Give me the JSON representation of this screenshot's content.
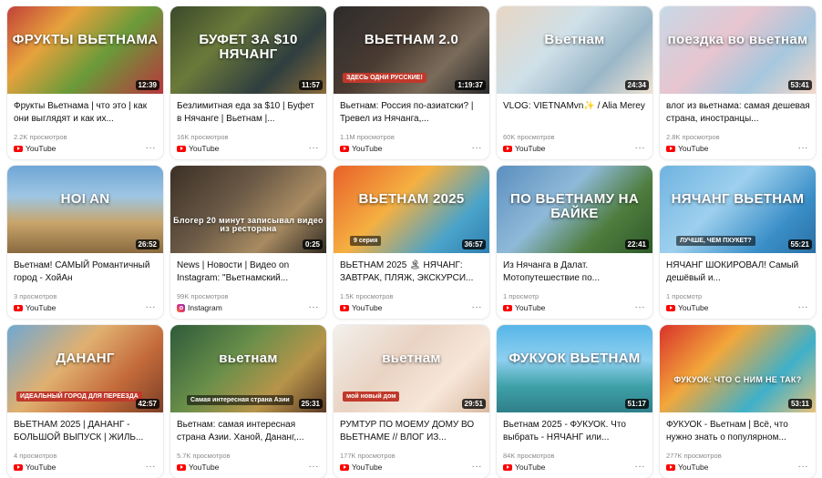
{
  "cards": [
    {
      "title": "Фрукты Вьетнама | что это | как они выглядят и как их...",
      "views": "2.2K просмотров",
      "source": "YouTube",
      "source_icon": "youtube-icon",
      "duration": "12:39",
      "thumb_text": "ФРУКТЫ ВЬЕТНАМА",
      "thumb_bg": "linear-gradient(135deg,#c2413a 0%,#e6a23c 30%,#6a9a3a 60%,#b8373d 100%)"
    },
    {
      "title": "Безлимитная еда за $10 | Буфет в Нячанге | Вьетнам |...",
      "views": "16K просмотров",
      "source": "YouTube",
      "source_icon": "youtube-icon",
      "duration": "11:57",
      "thumb_text": "БУФЕТ ЗА $10 НЯЧАНГ",
      "thumb_bg": "linear-gradient(135deg,#3a4a2a 0%,#6b7a3a 35%,#2f3e3f 70%,#8a6b3a 100%)"
    },
    {
      "title": "Вьетнам: Россия по-азиатски? |Тревел из Нячанга,...",
      "views": "1.1M просмотров",
      "source": "YouTube",
      "source_icon": "youtube-icon",
      "duration": "1:19:37",
      "thumb_text": "ВЬЕТНАМ 2.0",
      "thumb_bg": "linear-gradient(135deg,#2c2c2c 0%,#4a3b32 40%,#7a6b5a 70%,#2a2a2a 100%)",
      "sub_text": "ЗДЕСЬ ОДНИ РУССКИЕ!"
    },
    {
      "title": "VLOG: VIETNAMvn✨ / Alia Merey",
      "views": "60K просмотров",
      "source": "YouTube",
      "source_icon": "youtube-icon",
      "duration": "24:34",
      "thumb_text": "Вьетнам",
      "thumb_bg": "linear-gradient(135deg,#e8d6c4 0%,#cfe0e8 40%,#9ab7c9 70%,#f0e2d3 100%)"
    },
    {
      "title": "влог из вьетнама: самая дешевая страна, иностранцы...",
      "views": "2.8K просмотров",
      "source": "YouTube",
      "source_icon": "youtube-icon",
      "duration": "53:41",
      "thumb_text": "поездка во вьетнам",
      "thumb_bg": "linear-gradient(135deg,#c7d9e6 0%,#e7c5cf 40%,#a6c7de 70%,#f3d7c8 100%)"
    },
    {
      "title": "Вьетнам! САМЫЙ Романтичный город - ХойАн",
      "views": "3 просмотров",
      "source": "YouTube",
      "source_icon": "youtube-icon",
      "duration": "26:52",
      "thumb_text": "HOI AN",
      "thumb_bg": "linear-gradient(180deg,#6fa6d6 0%,#9ec6e3 35%,#c8a56b 65%,#8a6a3f 100%)"
    },
    {
      "title": "News | Новости | Видео on Instagram: \"Вьетнамский...",
      "views": "99K просмотров",
      "source": "Instagram",
      "source_icon": "instagram-icon",
      "duration": "0:25",
      "thumb_text": "Блогер 20 минут записывал видео из ресторана",
      "thumb_bg": "linear-gradient(135deg,#3b2f26 0%,#6b5a46 40%,#a88b62 70%,#2f2a22 100%)"
    },
    {
      "title": "ВЬЕТНАМ 2025 🏝 НЯЧАНГ: ЗАВТРАК, ПЛЯЖ, ЭКСКУРСИ...",
      "views": "1.5K просмотров",
      "source": "YouTube",
      "source_icon": "youtube-icon",
      "duration": "36:57",
      "thumb_text": "ВЬЕТНАМ 2025",
      "thumb_bg": "linear-gradient(135deg,#e9602a 0%,#f5b041 40%,#4aa3c9 75%,#2d7fb0 100%)",
      "sub_text": "9 серия"
    },
    {
      "title": "Из Нячанга в Далат. Мотопутешествие по...",
      "views": "1 просмотр",
      "source": "YouTube",
      "source_icon": "youtube-icon",
      "duration": "22:41",
      "thumb_text": "ПО ВЬЕТНАМУ НА БАЙКЕ",
      "thumb_bg": "linear-gradient(135deg,#5b8fbf 0%,#8fb9d8 40%,#4e7d3e 70%,#2f5a2a 100%)"
    },
    {
      "title": "НЯЧАНГ ШОКИРОВАЛ! Самый дешёвый и...",
      "views": "1 просмотр",
      "source": "YouTube",
      "source_icon": "youtube-icon",
      "duration": "55:21",
      "thumb_text": "НЯЧАНГ ВЬЕТНАМ",
      "thumb_bg": "linear-gradient(135deg,#6fb3e0 0%,#9ed0ee 40%,#3a8fc8 75%,#2a6fa3 100%)",
      "sub_text": "ЛУЧШЕ, ЧЕМ ПХУКЕТ?"
    },
    {
      "title": "ВЬЕТНАМ 2025 | ДАНАНГ - БОЛЬШОЙ ВЫПУСК | ЖИЛЬ...",
      "views": "4 просмотров",
      "source": "YouTube",
      "source_icon": "youtube-icon",
      "duration": "42:57",
      "thumb_text": "ДАНАНГ",
      "thumb_bg": "linear-gradient(135deg,#6fa8d3 0%,#e0b070 40%,#c46a3a 70%,#7a3f26 100%)",
      "sub_text": "ИДЕАЛЬНЫЙ ГОРОД ДЛЯ ПЕРЕЕЗДА"
    },
    {
      "title": "Вьетнам: самая интересная страна Азии. Ханой, Дананг,...",
      "views": "5.7K просмотров",
      "source": "YouTube",
      "source_icon": "youtube-icon",
      "duration": "25:31",
      "thumb_text": "вьетнам",
      "thumb_bg": "linear-gradient(135deg,#2e5a3a 0%,#6a8f4a 40%,#b7944a 70%,#5a3a26 100%)",
      "sub_text": "Самая интересная страна Азии"
    },
    {
      "title": "РУМТУР ПО МОЕМУ ДОМУ ВО ВЬЕТНАМЕ // ВЛОГ ИЗ...",
      "views": "177K просмотров",
      "source": "YouTube",
      "source_icon": "youtube-icon",
      "duration": "29:51",
      "thumb_text": "вьетнам",
      "thumb_bg": "linear-gradient(135deg,#f3f0ec 0%,#e9d3c3 40%,#f7e7d9 70%,#d9b8a0 100%)",
      "sub_text": "мой новый дом"
    },
    {
      "title": "Вьетнам 2025 - ФУКУОК. Что выбрать - НЯЧАНГ или...",
      "views": "84K просмотров",
      "source": "YouTube",
      "source_icon": "youtube-icon",
      "duration": "51:17",
      "thumb_text": "ФУКУОК ВЬЕТНАМ",
      "thumb_bg": "linear-gradient(180deg,#57b6e8 0%,#8fd0f0 40%,#3fa1a8 70%,#2f7f8a 100%)"
    },
    {
      "title": "ФУКУОК - Вьетнам | Всё, что нужно знать о популярном...",
      "views": "277K просмотров",
      "source": "YouTube",
      "source_icon": "youtube-icon",
      "duration": "53:11",
      "thumb_text": "ФУКУОК: ЧТО С НИМ НЕ ТАК?",
      "thumb_bg": "linear-gradient(135deg,#d9322a 0%,#f2a73b 35%,#3fb0c9 70%,#e6c27a 100%)"
    }
  ],
  "more_label": "···"
}
